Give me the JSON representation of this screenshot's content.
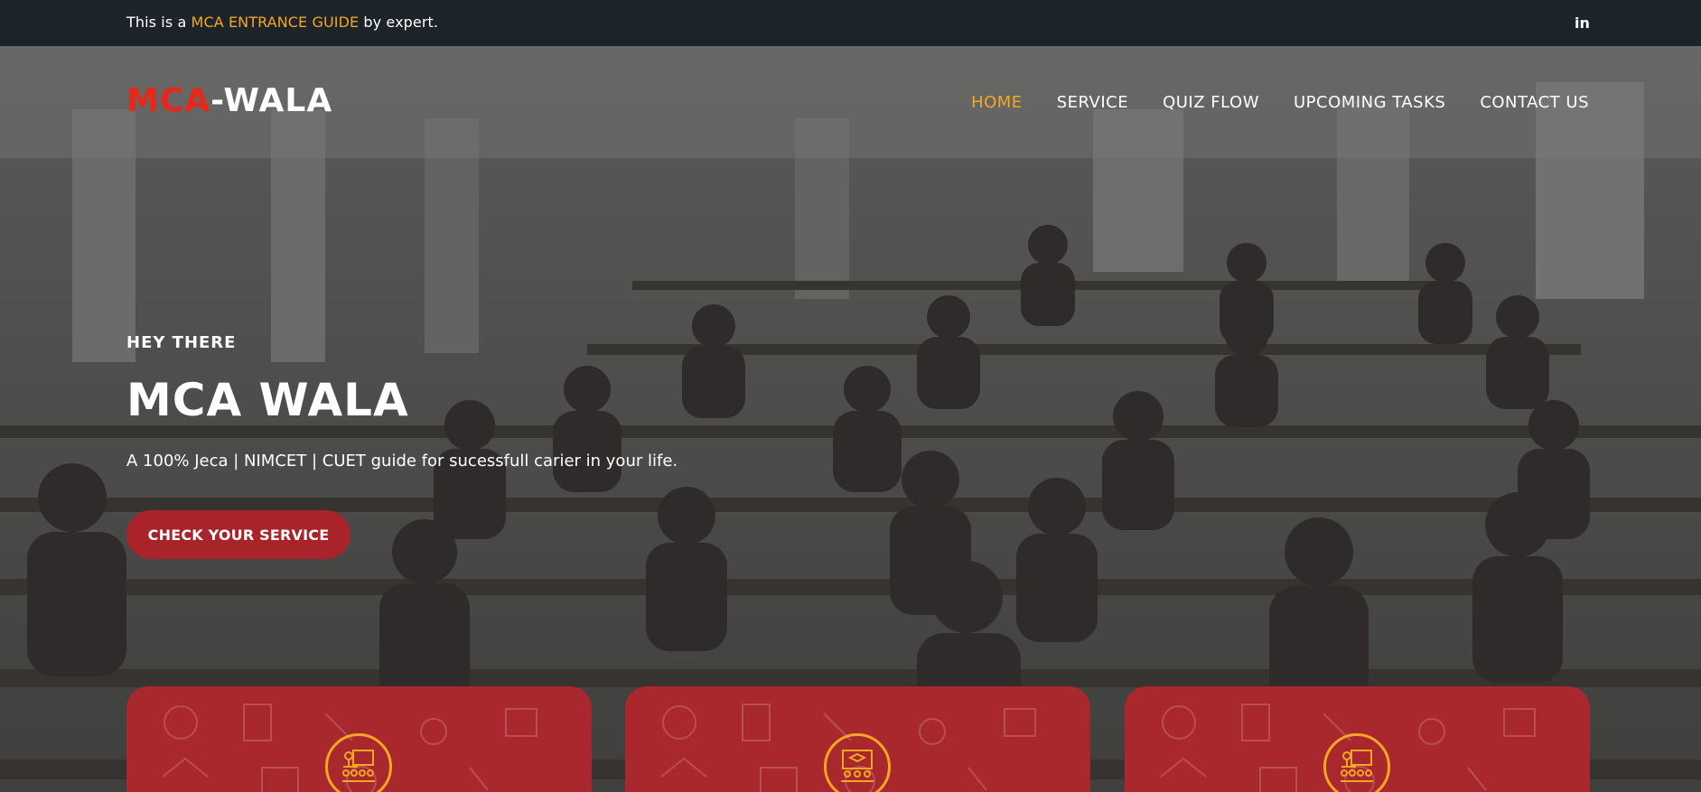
{
  "topbar": {
    "text_prefix": "This is a ",
    "text_highlight": "MCA ENTRANCE GUIDE",
    "text_suffix": " by expert.",
    "social_icon": "linkedin-icon",
    "social_label": "in"
  },
  "header": {
    "logo_part1": "MCA",
    "logo_part2": "-WALA",
    "nav": [
      {
        "label": "HOME",
        "active": true
      },
      {
        "label": "SERVICE",
        "active": false
      },
      {
        "label": "QUIZ FLOW",
        "active": false
      },
      {
        "label": "UPCOMING TASKS",
        "active": false
      },
      {
        "label": "CONTACT US",
        "active": false
      }
    ]
  },
  "hero": {
    "eyebrow": "HEY THERE",
    "title": "MCA WALA",
    "subtitle": "A 100% Jeca | NIMCET | CUET guide for sucessfull carier in your life.",
    "cta_label": "CHECK YOUR SERVICE",
    "background": "classroom-photo"
  },
  "cards": [
    {
      "icon": "teacher-board-icon"
    },
    {
      "icon": "graduation-board-icon"
    },
    {
      "icon": "teacher-board-icon"
    }
  ],
  "colors": {
    "accent": "#f5a623",
    "brand_red": "#e8261a",
    "button_red": "#a8232a",
    "topbar_bg": "#1c2429"
  }
}
